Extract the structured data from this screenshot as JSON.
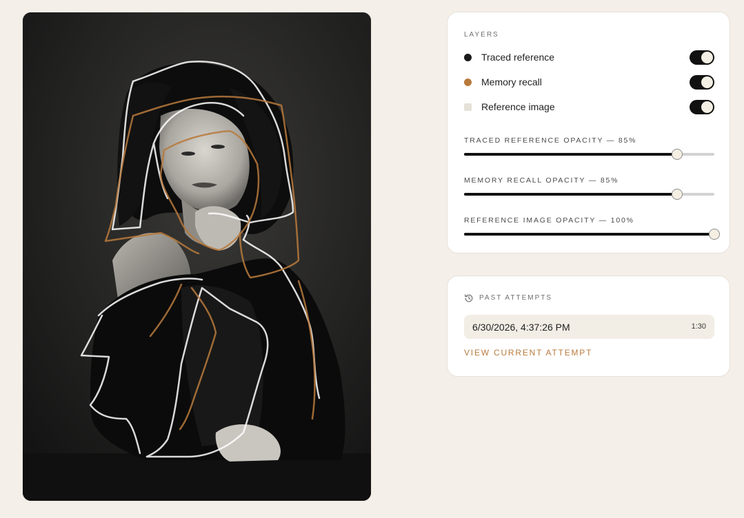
{
  "canvas": {
    "reference_icon": "portrait-photo",
    "traced_color": "#ffffff",
    "memory_color": "#b87a3c"
  },
  "layers": {
    "heading": "LAYERS",
    "items": [
      {
        "label": "Traced reference",
        "dot_color": "#1b1b1b",
        "enabled": true
      },
      {
        "label": "Memory recall",
        "dot_color": "#b87a3c",
        "enabled": true
      },
      {
        "label": "Reference image",
        "dot_color": "#e6e1d7",
        "enabled": true
      }
    ],
    "opacity": [
      {
        "label": "TRACED REFERENCE OPACITY — 85%",
        "value": 85
      },
      {
        "label": "MEMORY RECALL OPACITY — 85%",
        "value": 85
      },
      {
        "label": "REFERENCE IMAGE OPACITY — 100%",
        "value": 100
      }
    ]
  },
  "attempts": {
    "heading": "PAST ATTEMPTS",
    "icon": "history-icon",
    "items": [
      {
        "date": "6/30/2026, 4:37:26 PM",
        "duration": "1:30"
      }
    ],
    "view_current_label": "VIEW CURRENT ATTEMPT",
    "accent": "#b97a3e"
  }
}
